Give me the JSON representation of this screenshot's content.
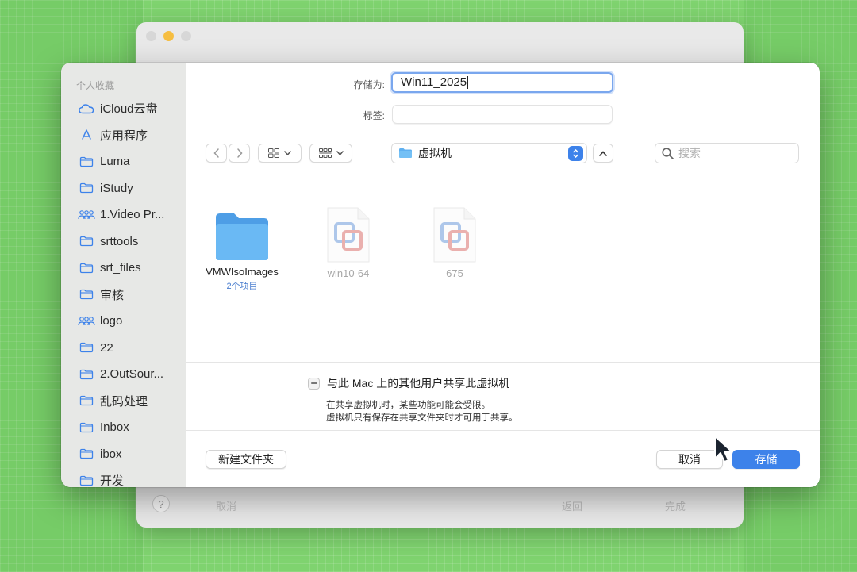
{
  "back_window": {
    "cancel_label": "取消",
    "back_label": "返回",
    "done_label": "完成",
    "help_label": "?"
  },
  "sidebar": {
    "header": "个人收藏",
    "items": [
      {
        "label": "iCloud云盘",
        "icon": "cloud-icon"
      },
      {
        "label": "应用程序",
        "icon": "applications-icon"
      },
      {
        "label": "Luma",
        "icon": "folder-icon"
      },
      {
        "label": "iStudy",
        "icon": "folder-icon"
      },
      {
        "label": "1.Video Pr...",
        "icon": "shared-folder-icon"
      },
      {
        "label": "srttools",
        "icon": "folder-icon"
      },
      {
        "label": "srt_files",
        "icon": "folder-icon"
      },
      {
        "label": "审核",
        "icon": "folder-icon"
      },
      {
        "label": "logo",
        "icon": "shared-folder-icon"
      },
      {
        "label": "22",
        "icon": "folder-icon"
      },
      {
        "label": "2.OutSour...",
        "icon": "folder-icon"
      },
      {
        "label": "乱码处理",
        "icon": "folder-icon"
      },
      {
        "label": "Inbox",
        "icon": "folder-icon"
      },
      {
        "label": "ibox",
        "icon": "folder-icon"
      },
      {
        "label": "开发",
        "icon": "folder-icon"
      }
    ]
  },
  "form": {
    "save_as_label": "存储为:",
    "save_as_value": "Win11_2025",
    "tags_label": "标签:",
    "tags_value": ""
  },
  "toolbar": {
    "location": "虚拟机",
    "search_placeholder": "搜索"
  },
  "files": [
    {
      "name": "VMWIsoImages",
      "subtitle": "2个项目",
      "type": "folder",
      "dimmed": false
    },
    {
      "name": "win10-64",
      "subtitle": "",
      "type": "vmware-doc",
      "dimmed": true
    },
    {
      "name": "675",
      "subtitle": "",
      "type": "vmware-doc",
      "dimmed": true
    }
  ],
  "share": {
    "label": "与此 Mac 上的其他用户共享此虚拟机",
    "note_line1": "在共享虚拟机时，某些功能可能会受限。",
    "note_line2": "虚拟机只有保存在共享文件夹时才可用于共享。"
  },
  "buttons": {
    "new_folder": "新建文件夹",
    "cancel": "取消",
    "save": "存储"
  },
  "colors": {
    "accent": "#3d82ea",
    "folder": "#5fb0f0",
    "background": "#7fd36f"
  }
}
